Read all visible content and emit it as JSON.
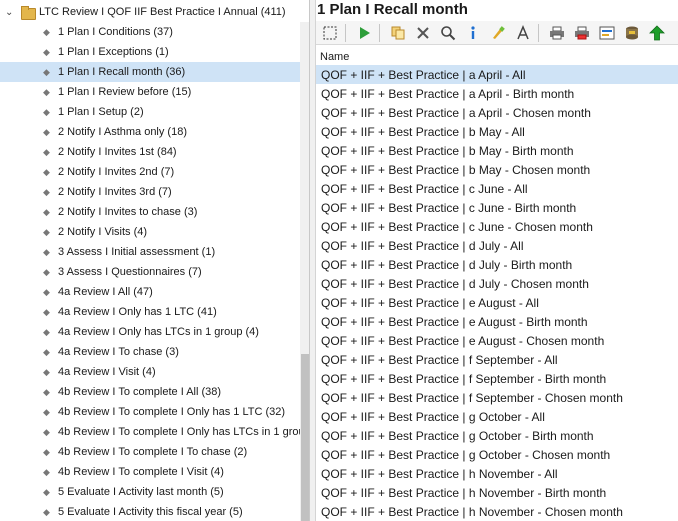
{
  "tree": {
    "root_label": "LTC Review I QOF IIF Best Practice I Annual (411)",
    "items": [
      {
        "label": "1 Plan I Conditions (37)"
      },
      {
        "label": "1 Plan I Exceptions (1)"
      },
      {
        "label": "1 Plan I Recall month (36)",
        "selected": true
      },
      {
        "label": "1 Plan I Review before (15)"
      },
      {
        "label": "1 Plan I Setup (2)"
      },
      {
        "label": "2 Notify I Asthma only (18)"
      },
      {
        "label": "2 Notify I Invites 1st (84)"
      },
      {
        "label": "2 Notify I Invites 2nd (7)"
      },
      {
        "label": "2 Notify I Invites 3rd (7)"
      },
      {
        "label": "2 Notify I Invites to chase (3)"
      },
      {
        "label": "2 Notify I Visits (4)"
      },
      {
        "label": "3 Assess I Initial assessment (1)"
      },
      {
        "label": "3 Assess I Questionnaires (7)"
      },
      {
        "label": "4a Review I All (47)"
      },
      {
        "label": "4a Review I Only has 1 LTC (41)"
      },
      {
        "label": "4a Review I Only has LTCs in 1 group (4)"
      },
      {
        "label": "4a Review I To chase (3)"
      },
      {
        "label": "4a Review I Visit (4)"
      },
      {
        "label": "4b Review I To complete I All (38)"
      },
      {
        "label": "4b Review I To complete I Only has 1 LTC (32)"
      },
      {
        "label": "4b Review I To complete I Only has LTCs in 1 grou"
      },
      {
        "label": "4b Review I To complete I To chase (2)"
      },
      {
        "label": "4b Review I To complete I Visit (4)"
      },
      {
        "label": "5 Evaluate I Activity last month (5)"
      },
      {
        "label": "5 Evaluate I Activity this fiscal year (5)"
      }
    ]
  },
  "panel": {
    "title": "1 Plan I Recall month",
    "column_header": "Name",
    "rows": [
      {
        "name": "QOF + IIF + Best Practice | a April - All",
        "selected": true
      },
      {
        "name": "QOF + IIF + Best Practice | a April - Birth month"
      },
      {
        "name": "QOF + IIF + Best Practice | a April - Chosen month"
      },
      {
        "name": "QOF + IIF + Best Practice | b May - All"
      },
      {
        "name": "QOF + IIF + Best Practice | b May - Birth month"
      },
      {
        "name": "QOF + IIF + Best Practice | b May - Chosen month"
      },
      {
        "name": "QOF + IIF + Best Practice | c June - All"
      },
      {
        "name": "QOF + IIF + Best Practice | c June - Birth month"
      },
      {
        "name": "QOF + IIF + Best Practice | c June - Chosen month"
      },
      {
        "name": "QOF + IIF + Best Practice | d July - All"
      },
      {
        "name": "QOF + IIF + Best Practice | d July - Birth month"
      },
      {
        "name": "QOF + IIF + Best Practice | d July - Chosen month"
      },
      {
        "name": "QOF + IIF + Best Practice | e August - All"
      },
      {
        "name": "QOF + IIF + Best Practice | e August - Birth month"
      },
      {
        "name": "QOF + IIF + Best Practice | e August - Chosen month"
      },
      {
        "name": "QOF + IIF + Best Practice | f September - All"
      },
      {
        "name": "QOF + IIF + Best Practice | f September - Birth month"
      },
      {
        "name": "QOF + IIF + Best Practice | f September - Chosen month"
      },
      {
        "name": "QOF + IIF + Best Practice | g October - All"
      },
      {
        "name": "QOF + IIF + Best Practice | g October - Birth month"
      },
      {
        "name": "QOF + IIF + Best Practice | g October - Chosen month"
      },
      {
        "name": "QOF + IIF + Best Practice | h November - All"
      },
      {
        "name": "QOF + IIF + Best Practice | h November - Birth month"
      },
      {
        "name": "QOF + IIF + Best Practice | h November - Chosen month"
      }
    ]
  },
  "toolbar": {
    "buttons": [
      "select-all-icon",
      "run-icon",
      "copy-icon",
      "delete-icon",
      "search-icon",
      "info-icon",
      "highlight-icon",
      "font-icon",
      "print-icon",
      "print-red-icon",
      "export-icon",
      "database-icon",
      "upload-icon"
    ]
  },
  "colors": {
    "selection": "#cfe3f6",
    "folder": "#e3b64b",
    "run": "#2e9e3a",
    "delete": "#555555",
    "info": "#1f6fd0",
    "upload": "#1e9e2a"
  }
}
